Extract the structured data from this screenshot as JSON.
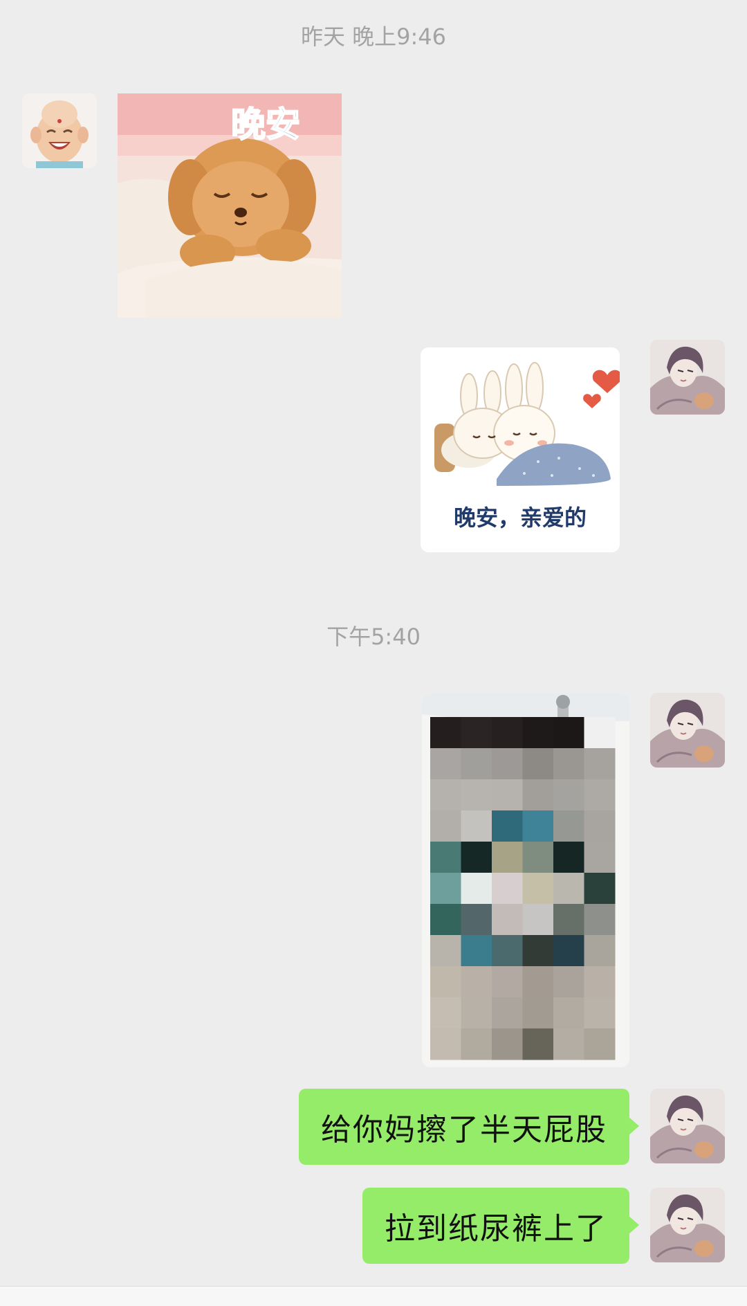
{
  "timestamps": {
    "first": "昨天 晚上9:46",
    "second": "下午5:40"
  },
  "stickers": {
    "goodnight_bear": {
      "caption": "晚安"
    },
    "goodnight_bunnies": {
      "caption": "晚安，亲爱的"
    }
  },
  "messages": [
    {
      "text": "给你妈擦了半天屁股"
    },
    {
      "text": "拉到纸尿裤上了"
    }
  ],
  "colors": {
    "background": "#ededed",
    "outgoing_bubble": "#95ec69",
    "timestamp_text": "#a3a3a3"
  }
}
